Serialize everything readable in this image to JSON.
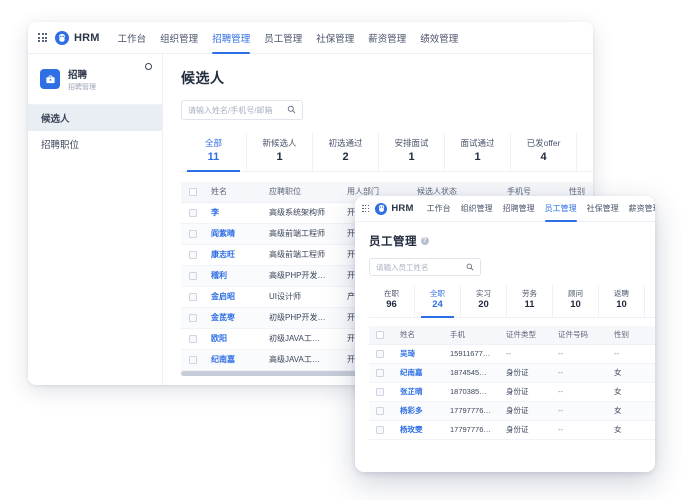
{
  "app": {
    "brand": "HRM",
    "grid_icon": "apps-grid-icon",
    "logo_icon": "hrm-owl-logo-icon"
  },
  "back_window": {
    "nav": {
      "items": [
        {
          "label": "工作台",
          "active": false
        },
        {
          "label": "组织管理",
          "active": false
        },
        {
          "label": "招聘管理",
          "active": true
        },
        {
          "label": "员工管理",
          "active": false
        },
        {
          "label": "社保管理",
          "active": false
        },
        {
          "label": "薪资管理",
          "active": false
        },
        {
          "label": "绩效管理",
          "active": false
        }
      ]
    },
    "sidebar": {
      "header_title": "招聘",
      "header_subtitle": "招聘管理",
      "header_icon": "briefcase-icon",
      "settings_icon": "gear-icon",
      "items": [
        {
          "label": "候选人",
          "active": true
        },
        {
          "label": "招聘职位",
          "active": false
        }
      ]
    },
    "page_title": "候选人",
    "search": {
      "placeholder": "请输入姓名/手机号/邮箱",
      "value": "",
      "icon": "search-icon"
    },
    "stat_tabs": [
      {
        "label": "全部",
        "value": "11",
        "active": true
      },
      {
        "label": "新候选人",
        "value": "1",
        "active": false
      },
      {
        "label": "初选通过",
        "value": "2",
        "active": false
      },
      {
        "label": "安排面试",
        "value": "1",
        "active": false
      },
      {
        "label": "面试通过",
        "value": "1",
        "active": false
      },
      {
        "label": "已发offer",
        "value": "4",
        "active": false
      }
    ],
    "table": {
      "columns": [
        "",
        "姓名",
        "应聘职位",
        "用人部门",
        "候选人状态",
        "手机号",
        "性别"
      ],
      "rows": [
        {
          "name": "李",
          "position": "高级系统架构师",
          "dept": "开发",
          "status": "",
          "phone": "",
          "gender": ""
        },
        {
          "name": "阎紫晴",
          "position": "高级前端工程师",
          "dept": "开发",
          "status": "",
          "phone": "",
          "gender": ""
        },
        {
          "name": "康志旺",
          "position": "高级前端工程师",
          "dept": "开发",
          "status": "",
          "phone": "",
          "gender": ""
        },
        {
          "name": "稽利",
          "position": "高级PHP开发…",
          "dept": "开发",
          "status": "",
          "phone": "",
          "gender": ""
        },
        {
          "name": "金启昭",
          "position": "UI设计师",
          "dept": "产品",
          "status": "",
          "phone": "",
          "gender": ""
        },
        {
          "name": "金茋枣",
          "position": "初级PHP开发…",
          "dept": "开发",
          "status": "",
          "phone": "",
          "gender": ""
        },
        {
          "name": "欧阳",
          "position": "初级JAVA工…",
          "dept": "开发",
          "status": "",
          "phone": "",
          "gender": ""
        },
        {
          "name": "纪南嘉",
          "position": "高级JAVA工…",
          "dept": "开发",
          "status": "",
          "phone": "",
          "gender": ""
        }
      ]
    }
  },
  "front_window": {
    "nav": {
      "items": [
        {
          "label": "工作台",
          "active": false
        },
        {
          "label": "组织管理",
          "active": false
        },
        {
          "label": "招聘管理",
          "active": false
        },
        {
          "label": "员工管理",
          "active": true
        },
        {
          "label": "社保管理",
          "active": false
        },
        {
          "label": "薪资管理",
          "active": false
        }
      ]
    },
    "page_title": "员工管理",
    "help_icon": "help-circle-icon",
    "help_glyph": "?",
    "search": {
      "placeholder": "请输入员工姓名",
      "value": "",
      "icon": "search-icon"
    },
    "stat_tabs": [
      {
        "label": "在职",
        "value": "96",
        "active": false
      },
      {
        "label": "全职",
        "value": "24",
        "active": true
      },
      {
        "label": "实习",
        "value": "20",
        "active": false
      },
      {
        "label": "劳务",
        "value": "11",
        "active": false
      },
      {
        "label": "顾问",
        "value": "10",
        "active": false
      },
      {
        "label": "返聘",
        "value": "10",
        "active": false
      }
    ],
    "table": {
      "columns": [
        "",
        "姓名",
        "手机",
        "证件类型",
        "证件号码",
        "性别"
      ],
      "rows": [
        {
          "name": "吴琦",
          "phone": "15911677…",
          "id_type": "--",
          "id_no": "--",
          "gender": "--"
        },
        {
          "name": "纪南嘉",
          "phone": "1874545…",
          "id_type": "身份证",
          "id_no": "--",
          "gender": "女"
        },
        {
          "name": "张芷晴",
          "phone": "1870385…",
          "id_type": "身份证",
          "id_no": "--",
          "gender": "女"
        },
        {
          "name": "杨彩多",
          "phone": "17797776…",
          "id_type": "身份证",
          "id_no": "--",
          "gender": "女"
        },
        {
          "name": "杨玫雯",
          "phone": "17797776…",
          "id_type": "身份证",
          "id_no": "--",
          "gender": "女"
        }
      ]
    }
  },
  "colors": {
    "accent": "#2f6fe4",
    "page_bg": "#ffffff",
    "panel_bg": "#ffffff",
    "header_row_bg": "#f5f7fa",
    "text_primary": "#222c3f",
    "text_secondary": "#5d6679"
  }
}
